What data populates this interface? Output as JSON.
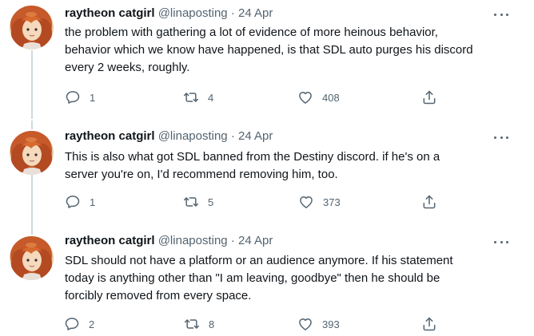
{
  "tweets": [
    {
      "name": "raytheon catgirl",
      "handle": "@linaposting",
      "separator": "·",
      "date": "24 Apr",
      "lines": [
        "the problem with gathering a lot of evidence of more heinous behavior,",
        "behavior which we know have happened, is that SDL auto purges his discord",
        "every 2 weeks, roughly."
      ],
      "replies": "1",
      "retweets": "4",
      "likes": "408"
    },
    {
      "name": "raytheon catgirl",
      "handle": "@linaposting",
      "separator": "·",
      "date": "24 Apr",
      "lines": [
        "This is also what got SDL banned from the Destiny discord. if he's on a",
        "server you're on, I'd recommend removing him, too."
      ],
      "replies": "1",
      "retweets": "5",
      "likes": "373"
    },
    {
      "name": "raytheon catgirl",
      "handle": "@linaposting",
      "separator": "·",
      "date": "24 Apr",
      "lines": [
        "SDL should not have a platform or an audience anymore. If his statement",
        "today is anything other than \"I am leaving, goodbye\" then he should be",
        "forcibly removed from every space."
      ],
      "replies": "2",
      "retweets": "8",
      "likes": "393"
    }
  ],
  "icons": {
    "reply": "reply-icon",
    "retweet": "retweet-icon",
    "like": "heart-icon",
    "share": "share-icon",
    "more": "more-icon"
  },
  "colors": {
    "text": "#0f1419",
    "secondary": "#536471",
    "thread_line": "#cfd9de"
  }
}
